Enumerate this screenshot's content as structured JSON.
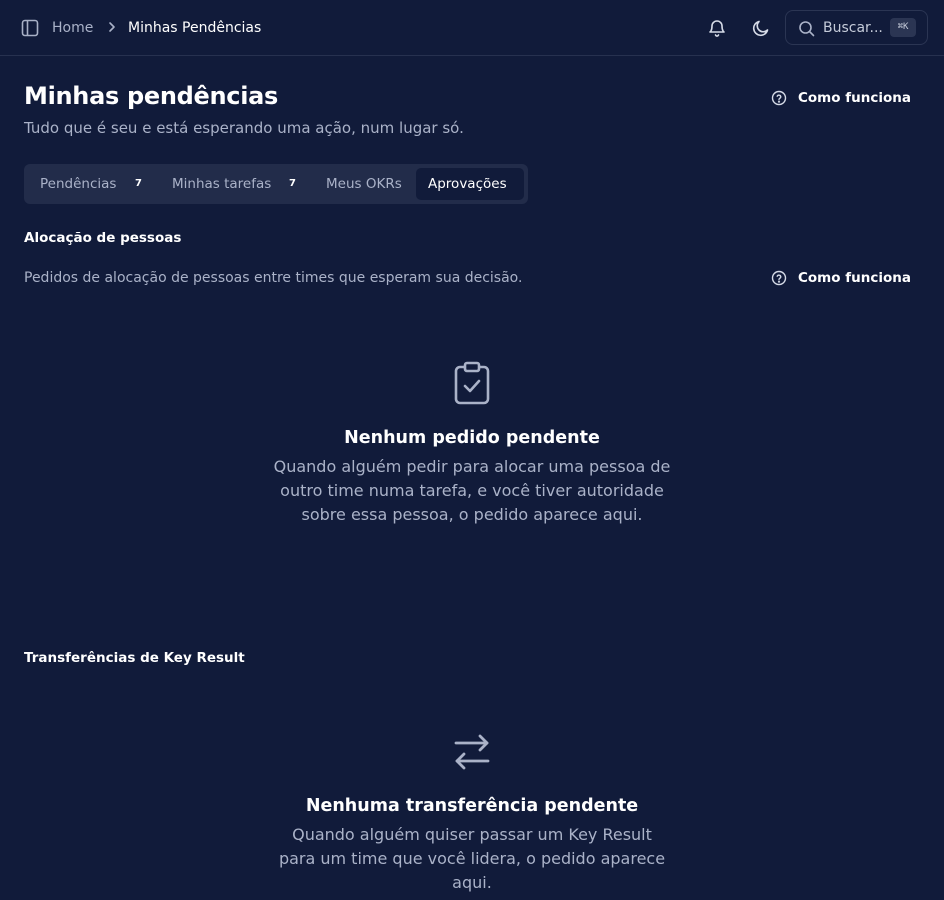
{
  "header": {
    "breadcrumb_home": "Home",
    "breadcrumb_current": "Minhas Pendências",
    "search_label": "Buscar...",
    "search_shortcut": "⌘K"
  },
  "page": {
    "title": "Minhas pendências",
    "subtitle": "Tudo que é seu e está esperando uma ação, num lugar só.",
    "how_it_works": "Como funciona"
  },
  "tabs": [
    {
      "label": "Pendências",
      "badge": "7",
      "active": false
    },
    {
      "label": "Minhas tarefas",
      "badge": "7",
      "active": false
    },
    {
      "label": "Meus OKRs",
      "badge": "",
      "active": false
    },
    {
      "label": "Aprovações",
      "badge": "",
      "active": true
    }
  ],
  "sections": {
    "allocation": {
      "title": "Alocação de pessoas",
      "description": "Pedidos de alocação de pessoas entre times que esperam sua decisão.",
      "how_it_works": "Como funciona",
      "empty_icon": "clipboard-check-icon",
      "empty_title": "Nenhum pedido pendente",
      "empty_desc": "Quando alguém pedir para alocar uma pessoa de outro time numa tarefa, e você tiver autoridade sobre essa pessoa, o pedido aparece aqui."
    },
    "transfers": {
      "title": "Transferências de Key Result",
      "empty_icon": "arrows-left-right-icon",
      "empty_title": "Nenhuma transferência pendente",
      "empty_desc": "Quando alguém quiser passar um Key Result para um time que você lidera, o pedido aparece aqui."
    }
  },
  "colors": {
    "background": "#111b3a",
    "muted_text": "#aab2c8",
    "tab_bar": "#222c4a"
  }
}
